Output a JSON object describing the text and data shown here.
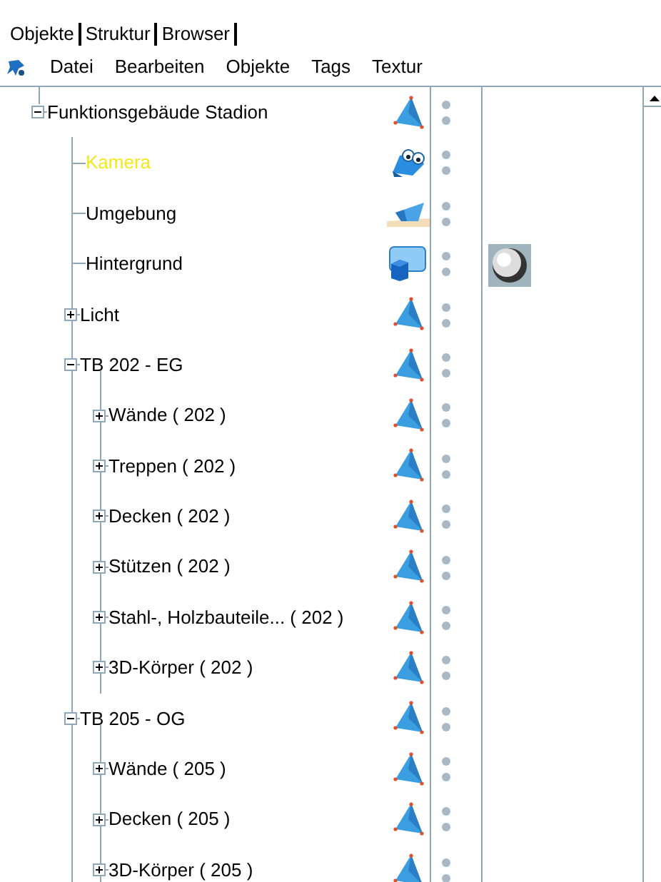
{
  "tabs": [
    {
      "label": "Objekte"
    },
    {
      "label": "Struktur"
    },
    {
      "label": "Browser"
    }
  ],
  "menu": [
    "Datei",
    "Bearbeiten",
    "Objekte",
    "Tags",
    "Textur"
  ],
  "tree": [
    {
      "label": "Funktionsgebäude Stadion",
      "kind": "group",
      "expanded": true,
      "active": false,
      "children": [
        {
          "label": "Kamera",
          "kind": "camera",
          "active": true
        },
        {
          "label": "Umgebung",
          "kind": "environment",
          "active": false
        },
        {
          "label": "Hintergrund",
          "kind": "background",
          "active": false,
          "material": true
        },
        {
          "label": "Licht",
          "kind": "group",
          "expanded": false,
          "active": false
        },
        {
          "label": "TB 202 - EG",
          "kind": "group",
          "expanded": true,
          "active": false,
          "children": [
            {
              "label": "Wände ( 202 )",
              "kind": "group",
              "expanded": false,
              "active": false
            },
            {
              "label": "Treppen ( 202 )",
              "kind": "group",
              "expanded": false,
              "active": false
            },
            {
              "label": "Decken ( 202 )",
              "kind": "group",
              "expanded": false,
              "active": false
            },
            {
              "label": "Stützen ( 202 )",
              "kind": "group",
              "expanded": false,
              "active": false
            },
            {
              "label": "Stahl-, Holzbauteile... ( 202 )",
              "kind": "group",
              "expanded": false,
              "active": false
            },
            {
              "label": "3D-Körper ( 202 )",
              "kind": "group",
              "expanded": false,
              "active": false
            }
          ]
        },
        {
          "label": "TB 205 - OG",
          "kind": "group",
          "expanded": true,
          "active": false,
          "children": [
            {
              "label": "Wände ( 205 )",
              "kind": "group",
              "expanded": false,
              "active": false
            },
            {
              "label": "Decken ( 205 )",
              "kind": "group",
              "expanded": false,
              "active": false
            },
            {
              "label": "3D-Körper ( 205 )",
              "kind": "group",
              "expanded": false,
              "active": false
            }
          ]
        }
      ]
    }
  ]
}
